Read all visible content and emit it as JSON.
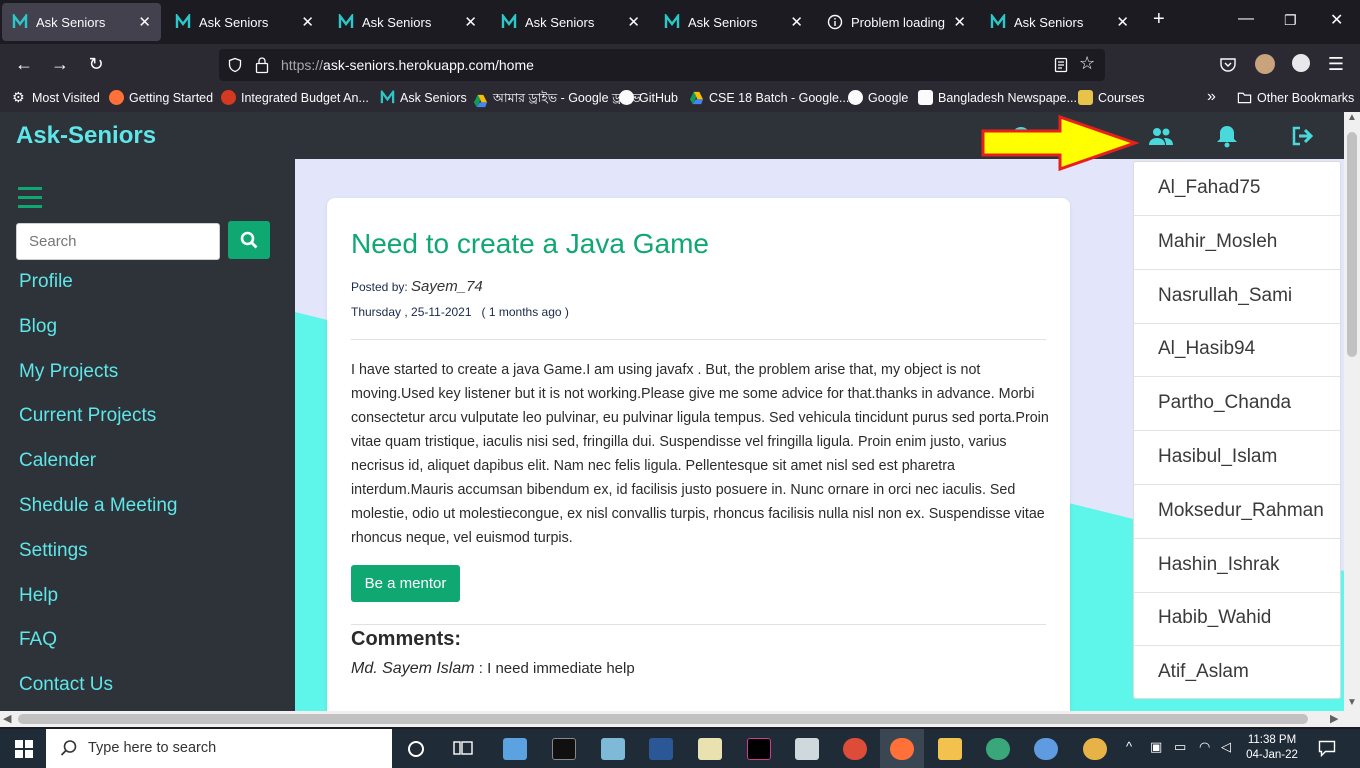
{
  "browser": {
    "tabs": [
      {
        "label": "Ask Seniors",
        "active": true
      },
      {
        "label": "Ask Seniors",
        "active": false
      },
      {
        "label": "Ask Seniors",
        "active": false
      },
      {
        "label": "Ask Seniors",
        "active": false
      },
      {
        "label": "Ask Seniors",
        "active": false
      },
      {
        "label": "Problem loading pa",
        "active": false
      },
      {
        "label": "Ask Seniors",
        "active": false
      }
    ],
    "new_tab_label": "+",
    "url": {
      "scheme": "https://",
      "host_path": "ask-seniors.herokuapp.com/home"
    },
    "bookmarks": [
      {
        "label": "Most Visited",
        "icon": "gear-icon"
      },
      {
        "label": "Getting Started",
        "icon": "firefox-icon"
      },
      {
        "label": "Integrated Budget An...",
        "icon": "budget-icon"
      },
      {
        "label": "Ask Seniors",
        "icon": "ask-seniors-icon"
      },
      {
        "label": "আমার ড্রাইভ - Google ড্রাইভ",
        "icon": "drive-icon"
      },
      {
        "label": "GitHub",
        "icon": "github-icon"
      },
      {
        "label": "CSE 18 Batch - Google...",
        "icon": "drive-icon"
      },
      {
        "label": "Google",
        "icon": "google-icon"
      },
      {
        "label": "Bangladesh Newspape...",
        "icon": "newspaper-icon"
      },
      {
        "label": "Courses",
        "icon": "courses-icon"
      }
    ],
    "other_bookmarks": "Other Bookmarks"
  },
  "app": {
    "brand": "Ask-Seniors",
    "search_placeholder": "Search",
    "sidebar_links": [
      "Profile",
      "Blog",
      "My Projects",
      "Current Projects",
      "Calender",
      "Shedule a Meeting",
      "Settings",
      "Help",
      "FAQ",
      "Contact Us"
    ],
    "top_icons": [
      "globe-icon",
      "home-icon",
      "users-icon",
      "bell-icon",
      "logout-icon"
    ]
  },
  "post": {
    "title": "Need to create a Java Game",
    "posted_by_label": "Posted by:",
    "author": "Sayem_74",
    "date": "Thursday , 25-11-2021",
    "ago": "( 1 months ago )",
    "body": "I have started to create a java Game.I am using javafx . But, the problem arise that, my object is not moving.Used key listener but it is not working.Please give me some advice for that.thanks in advance. Morbi consectetur arcu vulputate leo pulvinar, eu pulvinar ligula tempus. Sed vehicula tincidunt purus sed porta.Proin vitae quam tristique, iaculis nisi sed, fringilla dui. Suspendisse vel fringilla ligula. Proin enim justo, varius necrisus id, aliquet dapibus elit. Nam nec felis ligula. Pellentesque sit amet nisl sed est pharetra interdum.Mauris accumsan bibendum ex, id facilisis justo posuere in. Nunc ornare in orci nec iaculis. Sed molestie, odio ut molestiecongue, ex nisl convallis turpis, rhoncus facilisis nulla nisl non ex. Suspendisse vitae rhoncus neque, vel euismod turpis.",
    "mentor_button": "Be a mentor",
    "comments_heading": "Comments:",
    "comments": [
      {
        "author": "Md. Sayem Islam",
        "separator": " : ",
        "text": "I need immediate help"
      }
    ]
  },
  "users_dropdown": [
    "Al_Fahad75",
    "Mahir_Mosleh",
    "Nasrullah_Sami",
    "Al_Hasib94",
    "Partho_Chanda",
    "Hasibul_Islam",
    "Moksedur_Rahman",
    "Hashin_Ishrak",
    "Habib_Wahid",
    "Atif_Aslam"
  ],
  "taskbar": {
    "search_placeholder": "Type here to search",
    "time": "11:38 PM",
    "date": "04-Jan-22"
  },
  "colors": {
    "accent": "#0fa872",
    "brand": "#5ee6e9",
    "topbar": "#2d3339",
    "page_bg": "#e3e6fb",
    "teal_shape": "#5ef5ea",
    "arrow": "#ffff00",
    "arrow_border": "#e8201c"
  }
}
